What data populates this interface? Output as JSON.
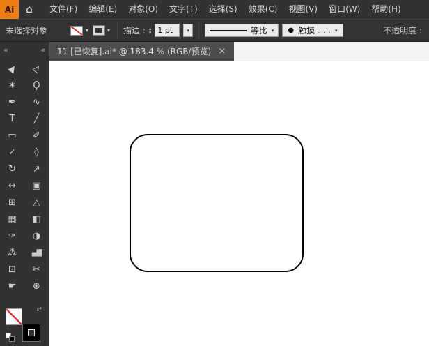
{
  "colors": {
    "chrome_bg": "#323232",
    "logo_bg": "#ed7d11",
    "logo_text": "#2b1700",
    "none_slash_red": "#e03131",
    "canvas_bg": "#ffffff",
    "shape_stroke": "#000000",
    "tab_bg": "#4d4d4d"
  },
  "menubar": {
    "logo_text": "Ai",
    "home_icon": "⌂",
    "items": [
      {
        "label": "文件(F)"
      },
      {
        "label": "编辑(E)"
      },
      {
        "label": "对象(O)"
      },
      {
        "label": "文字(T)"
      },
      {
        "label": "选择(S)"
      },
      {
        "label": "效果(C)"
      },
      {
        "label": "视图(V)"
      },
      {
        "label": "窗口(W)"
      },
      {
        "label": "帮助(H)"
      }
    ]
  },
  "control_bar": {
    "status": "未选择对象",
    "stroke_label": "描边 :",
    "stroke_value": "1 pt",
    "profile_label": "等比",
    "brush_label": "触摸 . . .",
    "opacity_label": "不透明度 :"
  },
  "icons": {
    "chevron": "▾",
    "close": "×",
    "collapse_left": "«",
    "collapse_right": "«",
    "swap": "⇄",
    "dot": "●",
    "step_up": "▴",
    "step_down": "▾"
  },
  "tabbar": {
    "title": "11 [已恢复].ai* @ 183.4 % (RGB/预览)"
  },
  "toolbar": {
    "tools": [
      {
        "name": "selection-tool",
        "glyph": "▶"
      },
      {
        "name": "direct-selection-tool",
        "glyph": "▷"
      },
      {
        "name": "magic-wand-tool",
        "glyph": "✶"
      },
      {
        "name": "lasso-tool",
        "glyph": "Ϙ"
      },
      {
        "name": "pen-tool",
        "glyph": "✒"
      },
      {
        "name": "curvature-tool",
        "glyph": "∿"
      },
      {
        "name": "type-tool",
        "glyph": "T"
      },
      {
        "name": "line-segment-tool",
        "glyph": "╱"
      },
      {
        "name": "rectangle-tool",
        "glyph": "▭"
      },
      {
        "name": "paintbrush-tool",
        "glyph": "✐"
      },
      {
        "name": "shaper-tool",
        "glyph": "✓"
      },
      {
        "name": "eraser-tool",
        "glyph": "◊"
      },
      {
        "name": "rotate-tool",
        "glyph": "↻"
      },
      {
        "name": "scale-tool",
        "glyph": "↗"
      },
      {
        "name": "width-tool",
        "glyph": "↔"
      },
      {
        "name": "free-transform-tool",
        "glyph": "▣"
      },
      {
        "name": "shape-builder-tool",
        "glyph": "⊞"
      },
      {
        "name": "perspective-grid-tool",
        "glyph": "△"
      },
      {
        "name": "mesh-tool",
        "glyph": "▦"
      },
      {
        "name": "gradient-tool",
        "glyph": "◧"
      },
      {
        "name": "eyedropper-tool",
        "glyph": "✑"
      },
      {
        "name": "blend-tool",
        "glyph": "◑"
      },
      {
        "name": "symbol-sprayer-tool",
        "glyph": "⁂"
      },
      {
        "name": "column-graph-tool",
        "glyph": "▄▇"
      },
      {
        "name": "artboard-tool",
        "glyph": "⊡"
      },
      {
        "name": "slice-tool",
        "glyph": "✂"
      },
      {
        "name": "hand-tool",
        "glyph": "☛"
      },
      {
        "name": "zoom-tool",
        "glyph": "⊕"
      }
    ]
  },
  "canvas": {
    "shape": {
      "type": "rounded-rectangle",
      "fill": "#ffffff",
      "stroke_color": "#000000",
      "stroke_width_px": 2,
      "corner_radius_px": 26
    }
  }
}
